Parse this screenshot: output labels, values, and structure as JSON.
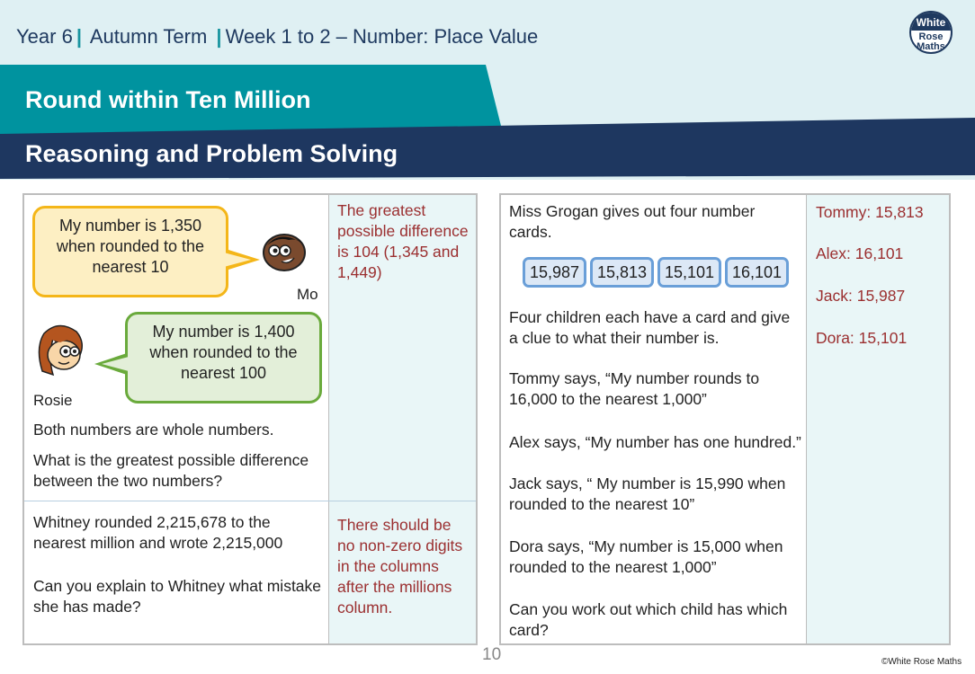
{
  "header": {
    "breadcrumb": [
      "Year 6",
      "Autumn Term",
      "Week 1 to 2 – Number: Place Value"
    ],
    "logo": {
      "line1": "White",
      "line2": "Rose",
      "line3": "Maths"
    },
    "title": "Round within Ten Million",
    "subtitle": "Reasoning and Problem Solving"
  },
  "colors": {
    "teal": "#00939f",
    "navy": "#1e3760",
    "answer_red": "#9b2f30",
    "answer_bg": "#e9f6f7"
  },
  "left_panel": {
    "q1": {
      "mo_bubble": [
        "My number is 1,350",
        "when rounded to the",
        "nearest 10"
      ],
      "mo_name": "Mo",
      "rosie_bubble": [
        "My number is 1,400",
        "when rounded to the",
        "nearest 100"
      ],
      "rosie_name": "Rosie",
      "text1": "Both numbers are whole numbers.",
      "text2": "What is the greatest possible difference between the two numbers?",
      "answer": "The greatest possible difference is 104 (1,345 and 1,449)"
    },
    "q2": {
      "text1": "Whitney rounded 2,215,678 to the nearest million and wrote 2,215,000",
      "text2": "Can you explain to Whitney what mistake she has made?",
      "answer": "There should be no non-zero digits in the columns after the millions column."
    }
  },
  "right_panel": {
    "intro": "Miss Grogan gives out four number cards.",
    "cards": [
      "15,987",
      "15,813",
      "15,101",
      "16,101"
    ],
    "clue_intro": "Four children each have a card and give a clue to what their number is.",
    "clues": [
      "Tommy says, “My number rounds to 16,000 to the nearest 1,000”",
      "Alex says, “My number has one hundred.”",
      "Jack says, “ My number is 15,990 when rounded to the nearest 10”",
      "Dora says, “My number is 15,000 when rounded to the nearest 1,000”"
    ],
    "question": "Can you work out which child has which card?",
    "answers": [
      "Tommy: 15,813",
      "Alex: 16,101",
      "Jack: 15,987",
      "Dora: 15,101"
    ]
  },
  "footer": {
    "page_number": "10",
    "copyright": "©White Rose Maths"
  }
}
